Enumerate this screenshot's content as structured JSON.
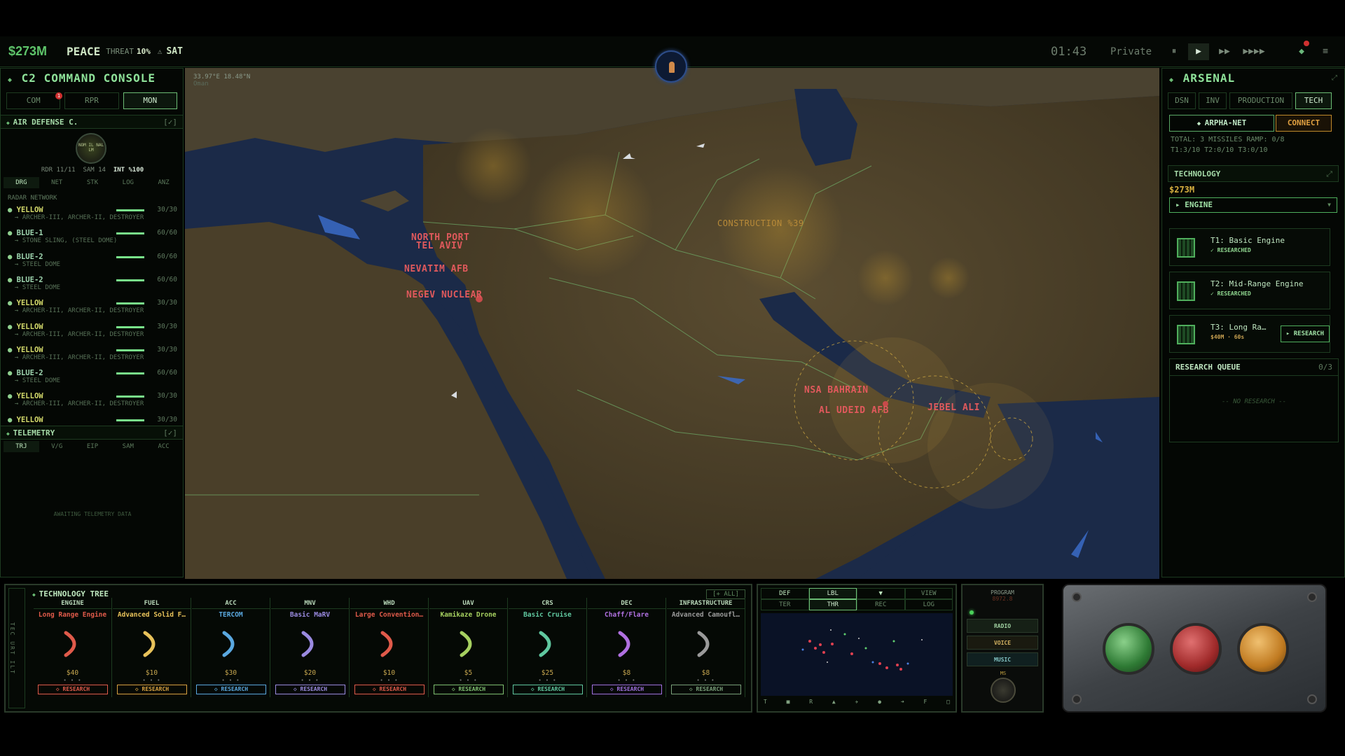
{
  "topbar": {
    "money": "$273M",
    "status": "PEACE",
    "threat_label": "THREAT",
    "threat_value": "10%",
    "threat_icon": "warning-triangle",
    "sat": "SAT",
    "clock": "01:43",
    "mode": "Private",
    "controls": [
      "pause-icon",
      "play-icon",
      "fast-forward-icon",
      "fastest-forward-icon"
    ],
    "notif_icon": "radar-notification-icon",
    "menu_icon": "hamburger-menu-icon"
  },
  "left": {
    "title": "C2 COMMAND CONSOLE",
    "tabs": [
      "COM",
      "RPR",
      "MON"
    ],
    "active_tab": "MON",
    "com_badge": "1",
    "air_defense": {
      "title": "AIR DEFENSE C.",
      "toggle": "[✓]",
      "emblem_text": "NOM IL NAL LM",
      "stats": [
        "RDR 11/11",
        "SAM 14",
        "INT %100"
      ]
    },
    "sub_tabs": [
      "DRG",
      "NET",
      "STK",
      "LOG",
      "ANZ"
    ],
    "radar_title": "RADAR NETWORK",
    "radar": [
      {
        "name": "YELLOW",
        "value": "30/30",
        "sub": "ARCHER-III, ARCHER-II, DESTROYER"
      },
      {
        "name": "BLUE-1",
        "value": "60/60",
        "sub": "STONE SLING, (STEEL DOME)"
      },
      {
        "name": "BLUE-2",
        "value": "60/60",
        "sub": "STEEL DOME"
      },
      {
        "name": "BLUE-2",
        "value": "60/60",
        "sub": "STEEL DOME"
      },
      {
        "name": "YELLOW",
        "value": "30/30",
        "sub": "ARCHER-III, ARCHER-II, DESTROYER"
      },
      {
        "name": "YELLOW",
        "value": "30/30",
        "sub": "ARCHER-III, ARCHER-II, DESTROYER"
      },
      {
        "name": "YELLOW",
        "value": "30/30",
        "sub": "ARCHER-III, ARCHER-II, DESTROYER"
      },
      {
        "name": "BLUE-2",
        "value": "60/60",
        "sub": "STEEL DOME"
      },
      {
        "name": "YELLOW",
        "value": "30/30",
        "sub": "ARCHER-III, ARCHER-II, DESTROYER"
      },
      {
        "name": "YELLOW",
        "value": "30/30",
        "sub": ""
      }
    ],
    "telemetry": {
      "title": "TELEMETRY",
      "toggle": "[✓]",
      "tabs": [
        "TRJ",
        "V/G",
        "EIP",
        "SAM",
        "ACC"
      ],
      "waiting": "AWAITING TELEMETRY DATA"
    }
  },
  "map": {
    "coords": "33.97°E 18.48°N",
    "region": "Oman",
    "labels": [
      "NORTH PORT",
      "TEL AVIV",
      "NEVATIM AFB",
      "NEGEV NUCLEAR",
      "CONSTRUCTION %39",
      "NSA BAHRAIN",
      "AL UDEID AFB",
      "JEBEL ALI"
    ]
  },
  "right": {
    "title": "ARSENAL",
    "tabs": [
      "DSN",
      "INV",
      "PRODUCTION",
      "TECH"
    ],
    "active_tab": "TECH",
    "network": "ARPHA-NET",
    "connect": "CONNECT",
    "total": "TOTAL: 3 MISSILES RAMP: 0/8",
    "tiers": "T1:3/10 T2:0/10 T3:0/10",
    "tech_title": "TECHNOLOGY",
    "tech_money": "$273M",
    "category": "ENGINE",
    "items": [
      {
        "name": "T1: Basic Engine",
        "status": "✓ RESEARCHED"
      },
      {
        "name": "T2: Mid-Range Engine",
        "status": "✓ RESEARCHED"
      },
      {
        "name": "T3: Long Ra…",
        "status": "$40M · 60s",
        "action": "RESEARCH"
      }
    ],
    "queue_title": "RESEARCH QUEUE",
    "queue_count": "0/3",
    "queue_empty": "-- NO RESEARCH --"
  },
  "tree": {
    "side_label": "TEC URT ILT",
    "title": "TECHNOLOGY TREE",
    "all": "[+ ALL]",
    "columns": [
      {
        "h": "ENGINE",
        "name": "Long Range Engine",
        "price": "$40",
        "color": "#e05a4a",
        "btn": "◇ RESEARCH",
        "btn_color": "#e05a4a"
      },
      {
        "h": "FUEL",
        "name": "Advanced Solid F…",
        "price": "$10",
        "color": "#e8c25a",
        "btn": "◇ RESEARCH",
        "btn_color": "#d8a040"
      },
      {
        "h": "ACC",
        "name": "TERCOM",
        "price": "$30",
        "color": "#5aa8e0",
        "btn": "◇ RESEARCH",
        "btn_color": "#5aa8e0"
      },
      {
        "h": "MNV",
        "name": "Basic MaRV",
        "price": "$20",
        "color": "#9a8ae0",
        "btn": "◇ RESEARCH",
        "btn_color": "#9a8ae0"
      },
      {
        "h": "WHD",
        "name": "Large Convention…",
        "price": "$10",
        "color": "#e05a4a",
        "btn": "◇ RESEARCH",
        "btn_color": "#e05a4a"
      },
      {
        "h": "UAV",
        "name": "Kamikaze Drone",
        "price": "$5",
        "color": "#a6d060",
        "btn": "◇ RESEARCH",
        "btn_color": "#7fc070"
      },
      {
        "h": "CRS",
        "name": "Basic Cruise",
        "price": "$25",
        "color": "#60c8a0",
        "btn": "◇ RESEARCH",
        "btn_color": "#60c8a0"
      },
      {
        "h": "DEC",
        "name": "Chaff/Flare",
        "price": "$8",
        "color": "#b070e0",
        "btn": "◇ RESEARCH",
        "btn_color": "#a070e0"
      },
      {
        "h": "INFRASTRUCTURE",
        "name": "Advanced Camoufl…",
        "price": "$8",
        "color": "#9a9a9a",
        "btn": "◇ RESEARCH",
        "btn_color": "#7aa07a"
      }
    ]
  },
  "minimap": {
    "tabs1": [
      "DEF",
      "LBL",
      "▼",
      "VIEW"
    ],
    "tabs2": [
      "TER",
      "THR",
      "REC",
      "LOG"
    ],
    "legend": [
      "T",
      "■",
      "R",
      "▲",
      "✈",
      "●",
      "➜",
      "F",
      "□"
    ]
  },
  "radio": {
    "program": "PROGRAM",
    "freq": "8972.8",
    "buttons": [
      "RADIO",
      "VOICE",
      "MUSIC"
    ],
    "dial": "MS"
  },
  "console_buttons": [
    "green-button",
    "red-button",
    "orange-button"
  ]
}
